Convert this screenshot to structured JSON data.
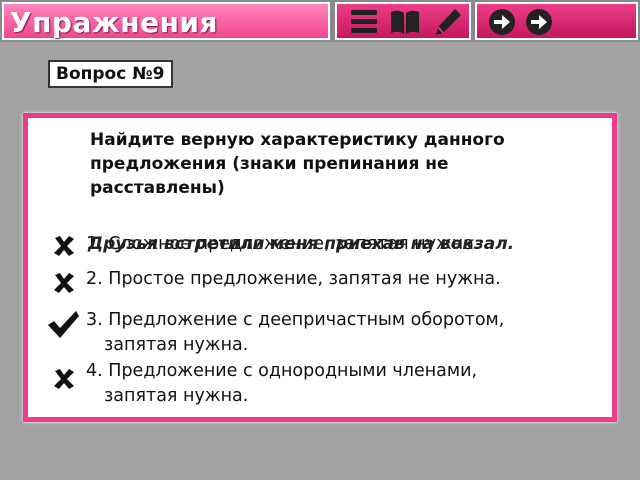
{
  "header": {
    "title": "Упражнения",
    "tools": [
      {
        "icon": "menu-icon"
      },
      {
        "icon": "book-icon"
      },
      {
        "icon": "pencil-icon"
      }
    ],
    "nav": [
      {
        "icon": "next-arrow-icon"
      },
      {
        "icon": "next-arrow-icon"
      }
    ]
  },
  "question": {
    "number_label": "Вопрос №9",
    "prompt": "Найдите верную характеристику данного предложения (знаки препинания не расставлены)",
    "sentence": "Друзья встретили меня приехав на вокзал."
  },
  "answers": [
    {
      "number": "1.",
      "text": "Сложное предложение, запятая нужна.",
      "mark": "cross-icon"
    },
    {
      "number": "2.",
      "text": "Простое предложение, запятая не нужна.",
      "mark": "cross-icon"
    },
    {
      "number": "3.",
      "line1": "Предложение с деепричастным оборотом,",
      "line2": "запятая нужна.",
      "mark": "check-icon"
    },
    {
      "number": "4.",
      "line1": "Предложение с однородными членами,",
      "line2": "запятая нужна.",
      "mark": "cross-icon"
    }
  ],
  "colors": {
    "accent": "#ec3c8a",
    "header_pink": "#f0468f",
    "background": "#a3a3a3"
  }
}
